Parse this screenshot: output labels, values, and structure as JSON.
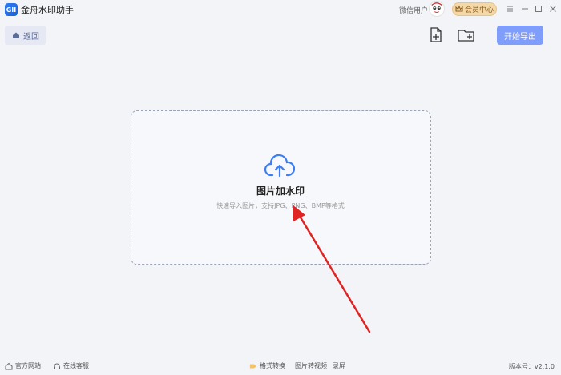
{
  "app": {
    "logo_text": "GII",
    "title": "金舟水印助手"
  },
  "user": {
    "name": "微信用户"
  },
  "vip": {
    "label": "会员中心"
  },
  "toolbar": {
    "back_label": "返回",
    "export_label": "开始导出"
  },
  "dropzone": {
    "title": "图片加水印",
    "subtitle": "快速导入图片，支持JPG、PNG、BMP等格式"
  },
  "footer": {
    "website": "官方网站",
    "support": "在线客服",
    "format_convert": "格式转换",
    "img_to_video": "图片转视频",
    "record": "录屏",
    "version": "版本号：v2.1.0"
  },
  "colors": {
    "accent": "#7f9dfa",
    "vip": "#f4d9a8",
    "arrow": "#e02424",
    "cloud": "#3d7ef2"
  }
}
